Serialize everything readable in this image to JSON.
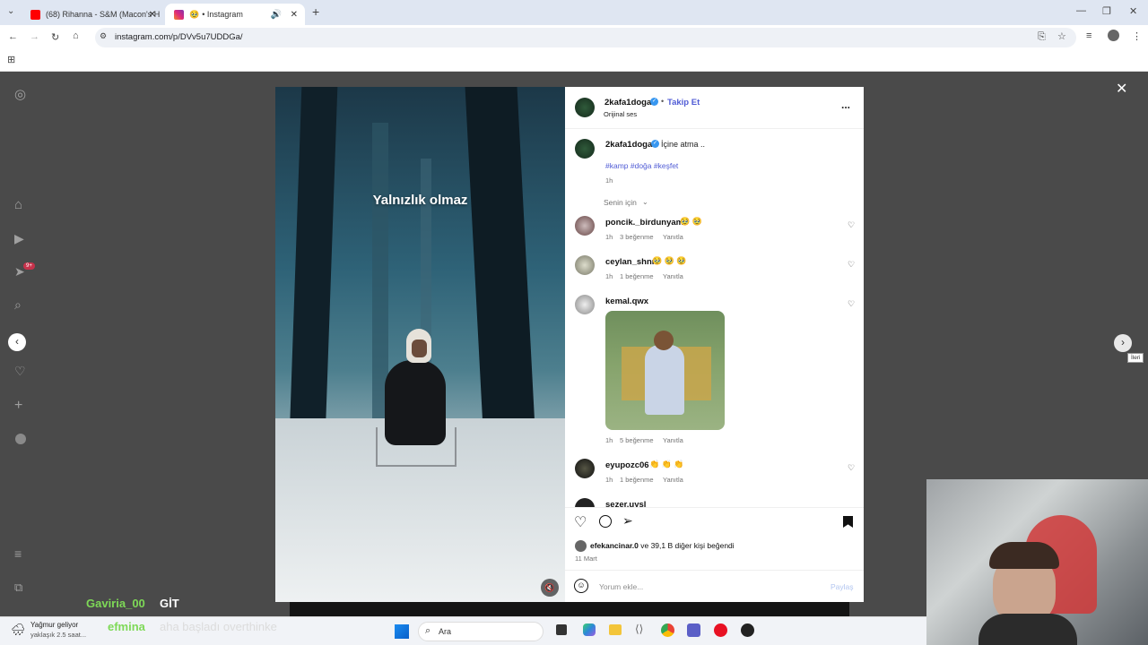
{
  "browser": {
    "tabs": [
      {
        "title": "(68) Rihanna - S&M (Macon's H",
        "favicon_color": "#ff0000"
      },
      {
        "title": "• Instagram",
        "favicon_color": "#e1306c"
      }
    ],
    "url": "instagram.com/p/DVv5u7UDDGa/"
  },
  "post": {
    "overlay_text": "Yalnızlık olmaz",
    "header": {
      "username": "2kafa1doga",
      "follow": "Takip Et",
      "audio": "Orijinal ses",
      "more": "..."
    },
    "caption": {
      "username": "2kafa1doga",
      "text": "İçine atma ..",
      "hashtags": "#kamp #doğa #keşfet",
      "time": "1h"
    },
    "sort_label": "Senin için",
    "comments": [
      {
        "username": "poncik._birdunyam",
        "emojis": "🥹 🥹",
        "time": "1h",
        "likes": "3 beğenme",
        "reply": "Yanıtla"
      },
      {
        "username": "ceylan_shnr",
        "emojis": "🥹 🥹 🥹",
        "time": "1h",
        "likes": "1 beğenme",
        "reply": "Yanıtla"
      },
      {
        "username": "kemal.qwx",
        "emojis": "",
        "time": "1h",
        "likes": "5 beğenme",
        "reply": "Yanıtla"
      },
      {
        "username": "eyupozc06",
        "emojis": "👏 👏 👏",
        "time": "1h",
        "likes": "1 beğenme",
        "reply": "Yanıtla"
      },
      {
        "username": "sezer.uysl",
        "emojis": "",
        "time": "",
        "likes": "",
        "reply": ""
      }
    ],
    "likes_line": {
      "user": "efekancinar.0",
      "rest": " ve 39,1 B diğer kişi beğendi"
    },
    "date": "11 Mart",
    "comment_placeholder": "Yorum ekle...",
    "share_label": "Paylaş",
    "tooltip_next": "İleri"
  },
  "stream": {
    "chat_user1": "Gaviria_00",
    "chat_msg1": "GİT",
    "chat_user2": "efmina",
    "chat_msg2": "aha başladı overthinke"
  },
  "taskbar": {
    "weather_title": "Yağmur geliyor",
    "weather_sub": "yaklaşık 2.5 saat...",
    "search_label": "Ara"
  },
  "notification_badge": "9+",
  "colors": {
    "accent": "#4f5bd5",
    "chat_user": "#7ed957"
  }
}
